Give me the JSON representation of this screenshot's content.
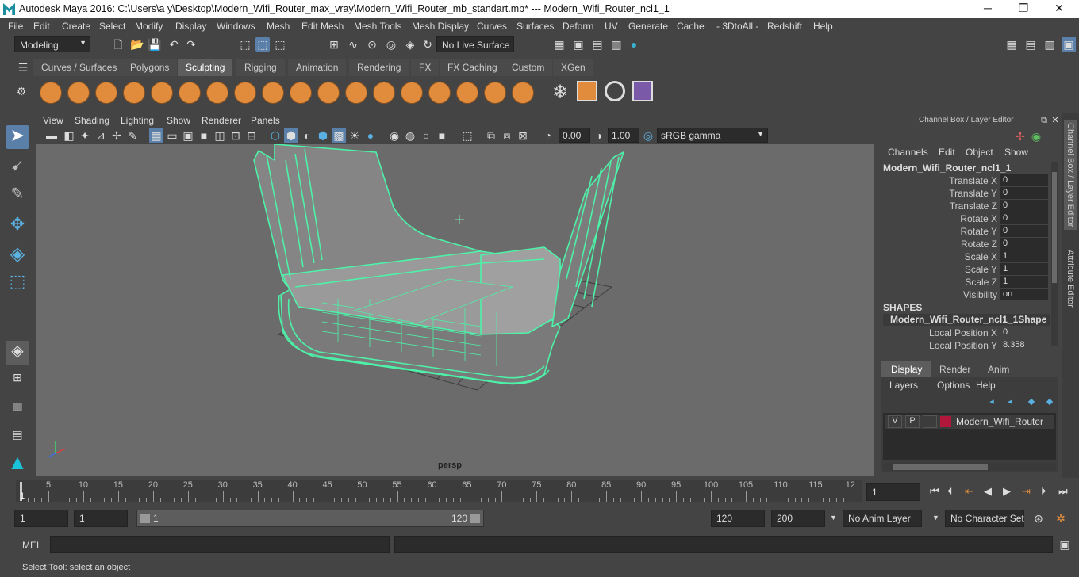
{
  "window": {
    "title": "Autodesk Maya 2016: C:\\Users\\a y\\Desktop\\Modern_Wifi_Router_max_vray\\Modern_Wifi_Router_mb_standart.mb*   ---   Modern_Wifi_Router_ncl1_1",
    "minimize": "─",
    "maximize": "❐",
    "close": "✕"
  },
  "menu": [
    "File",
    "Edit",
    "Create",
    "Select",
    "Modify",
    "Display",
    "Windows",
    "Mesh",
    "Edit Mesh",
    "Mesh Tools",
    "Mesh Display",
    "Curves",
    "Surfaces",
    "Deform",
    "UV",
    "Generate",
    "Cache",
    "- 3DtoAll -",
    "Redshift",
    "Help"
  ],
  "status": {
    "mode": "Modeling",
    "live_surface": "No Live Surface"
  },
  "shelf_tabs": [
    "Curves / Surfaces",
    "Polygons",
    "Sculpting",
    "Rigging",
    "Animation",
    "Rendering",
    "FX",
    "FX Caching",
    "Custom",
    "XGen"
  ],
  "shelf_active": "Sculpting",
  "viewport": {
    "menu": [
      "View",
      "Shading",
      "Lighting",
      "Show",
      "Renderer",
      "Panels"
    ],
    "exposure": "0.00",
    "gamma": "1.00",
    "colorspace": "sRGB gamma",
    "camera": "persp"
  },
  "channel_box": {
    "title": "Channel Box / Layer Editor",
    "menu": [
      "Channels",
      "Edit",
      "Object",
      "Show"
    ],
    "object": "Modern_Wifi_Router_ncl1_1",
    "channels": [
      {
        "label": "Translate X",
        "value": "0"
      },
      {
        "label": "Translate Y",
        "value": "0"
      },
      {
        "label": "Translate Z",
        "value": "0"
      },
      {
        "label": "Rotate X",
        "value": "0"
      },
      {
        "label": "Rotate Y",
        "value": "0"
      },
      {
        "label": "Rotate Z",
        "value": "0"
      },
      {
        "label": "Scale X",
        "value": "1"
      },
      {
        "label": "Scale Y",
        "value": "1"
      },
      {
        "label": "Scale Z",
        "value": "1"
      },
      {
        "label": "Visibility",
        "value": "on"
      }
    ],
    "shapes_header": "SHAPES",
    "shape_name": "Modern_Wifi_Router_ncl1_1Shape",
    "shape_channels": [
      {
        "label": "Local Position X",
        "value": "0"
      },
      {
        "label": "Local Position Y",
        "value": "8.358"
      }
    ]
  },
  "layer_editor": {
    "tabs": [
      "Display",
      "Render",
      "Anim"
    ],
    "menu": [
      "Layers",
      "Options",
      "Help"
    ],
    "layer": {
      "v": "V",
      "p": "P",
      "name": "Modern_Wifi_Router",
      "color": "#b0173a"
    }
  },
  "side_tabs": [
    "Channel Box / Layer Editor",
    "Attribute Editor"
  ],
  "timeline": {
    "ticks": [
      "5",
      "10",
      "15",
      "20",
      "25",
      "30",
      "35",
      "40",
      "45",
      "50",
      "55",
      "60",
      "65",
      "70",
      "75",
      "80",
      "85",
      "90",
      "95",
      "100",
      "105",
      "110",
      "115",
      "12"
    ],
    "start_marker": "1",
    "current_frame": "1"
  },
  "range": {
    "start": "1",
    "playback_start": "1",
    "slider_start": "1",
    "slider_end": "120",
    "playback_end": "120",
    "end": "200",
    "anim_layer": "No Anim Layer",
    "character_set": "No Character Set"
  },
  "command": {
    "label": "MEL"
  },
  "help_line": "Select Tool: select an object"
}
